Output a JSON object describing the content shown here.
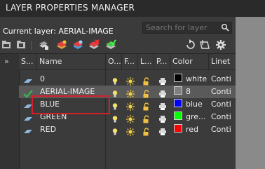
{
  "title": "LAYER PROPERTIES MANAGER",
  "current_layer": "Current layer: AERIAL-IMAGE",
  "search": {
    "placeholder": "Search for layer"
  },
  "columns": {
    "status": "S...",
    "name": "Name",
    "on": "O...",
    "freeze": "F...",
    "lock": "L...",
    "plot": "P...",
    "color": "Color",
    "linetype": "Linet"
  },
  "rows": [
    {
      "name": "0",
      "color_name": "white",
      "color_hex": "#000000",
      "linetype": "Conti",
      "current": false
    },
    {
      "name": "AERIAL-IMAGE",
      "color_name": "8",
      "color_hex": "#808080",
      "linetype": "Conti",
      "current": true
    },
    {
      "name": "BLUE",
      "color_name": "blue",
      "color_hex": "#0000ff",
      "linetype": "Conti",
      "current": false
    },
    {
      "name": "GREEN",
      "color_name": "gre...",
      "color_hex": "#00ff00",
      "linetype": "Conti",
      "current": false
    },
    {
      "name": "RED",
      "color_name": "red",
      "color_hex": "#ff0000",
      "linetype": "Conti",
      "current": false
    }
  ],
  "colors": {
    "highlight": "#d21f2a",
    "selected_row": "#5a5a5a",
    "current_check": "#39b54a"
  },
  "icons": [
    "new-property-filter-icon",
    "new-group-filter-icon",
    "layer-states-manager-icon",
    "new-layer-icon",
    "new-layer-vp-frozen-icon",
    "delete-layer-icon",
    "set-current-icon",
    "refresh-icon",
    "settings-icon",
    "search-icon",
    "expand-chevron-icon"
  ]
}
